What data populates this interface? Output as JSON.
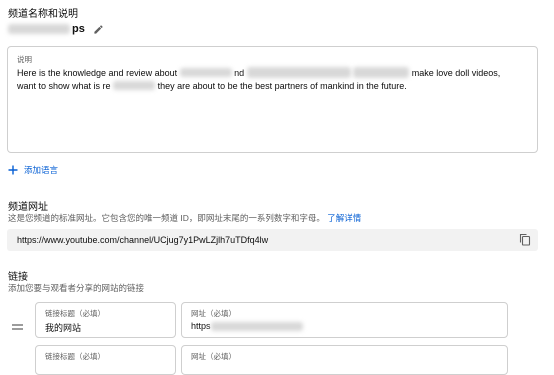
{
  "name_section": {
    "title": "频道名称和说明",
    "channel_name_suffix": "ps"
  },
  "description": {
    "label": "说明",
    "line1_a": "Here is the knowledge and review about",
    "line1_b": "nd",
    "line1_c": "make love doll videos,",
    "line2_a": "want to show what is re",
    "line2_b": "they are about to be the best partners of mankind in the future."
  },
  "add_language": "添加语言",
  "url_section": {
    "title": "频道网址",
    "desc_prefix": "这是您频道的标准网址。它包含您的唯一频道 ID，即网址末尾的一系列数字和字母。",
    "learn_more": "了解详情",
    "url": "https://www.youtube.com/channel/UCjug7y1PwLZjlh7uTDfq4lw"
  },
  "links_section": {
    "title": "链接",
    "desc": "添加您要与观看者分享的网站的链接",
    "link1": {
      "title_label": "链接标题（必填）",
      "title_value": "我的网站",
      "url_label": "网址（必填）",
      "url_value": "https"
    },
    "link2": {
      "title_label": "链接标题（必填）",
      "url_label": "网址（必填）"
    }
  }
}
